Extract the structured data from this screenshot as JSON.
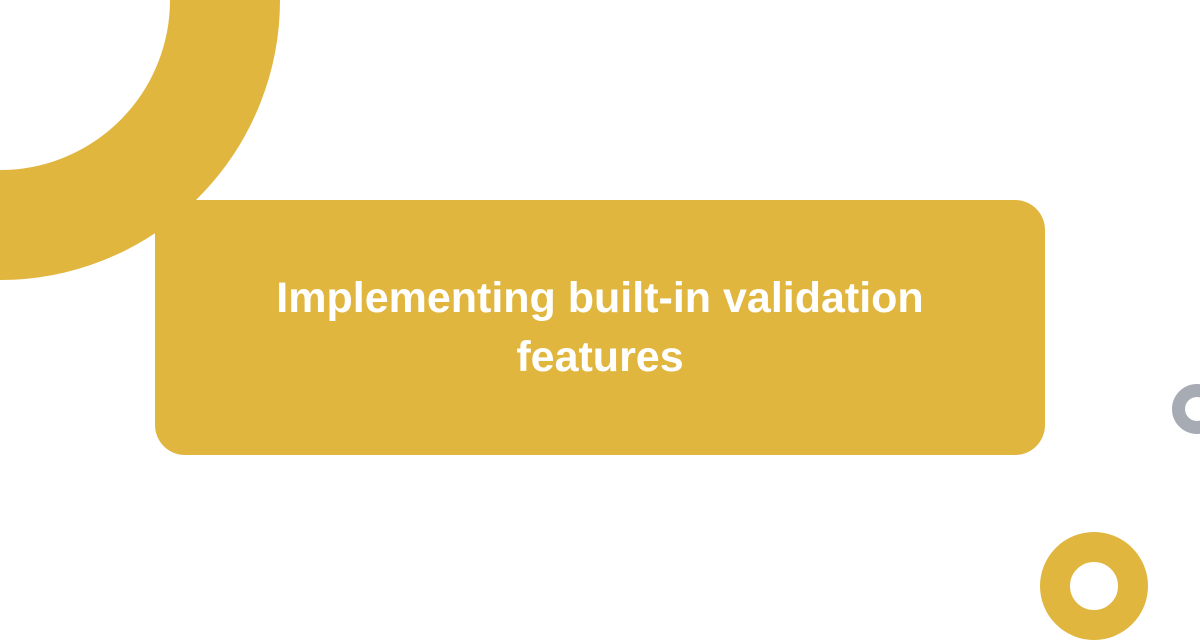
{
  "title": "Implementing built-in validation features",
  "colors": {
    "accent": "#e0b63e",
    "gray": "#a7abb3",
    "background": "#ffffff",
    "text": "#ffffff"
  }
}
